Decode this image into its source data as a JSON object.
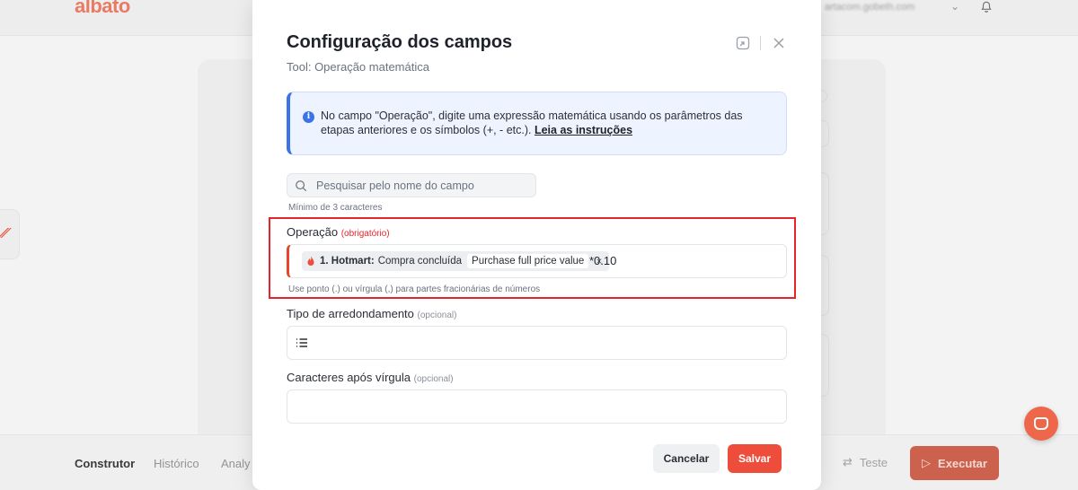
{
  "app": {
    "logo": "albato",
    "account": "artacom.gobeth.com",
    "bottom_tabs": [
      "Construtor",
      "Histórico",
      "Analy"
    ],
    "test_label": "Teste",
    "execute_label": "Executar"
  },
  "modal": {
    "title": "Configuração dos campos",
    "subtitle": "Tool: Operação matemática",
    "info": {
      "text": "No campo \"Operação\", digite uma expressão matemática usando os parâmetros das etapas anteriores e os símbolos (+, - etc.). ",
      "link": "Leia as instruções"
    },
    "search": {
      "placeholder": "Pesquisar pelo nome do campo",
      "hint": "Mínimo de 3 caracteres"
    },
    "fields": {
      "operacao": {
        "label": "Operação",
        "tag": "(obrigatório)",
        "chip_app": "1. Hotmart:",
        "chip_event": "Compra concluída",
        "chip_field": "Purchase full price value",
        "value": "*0.10",
        "hint": "Use ponto (.) ou vírgula (,) para partes fracionárias de números"
      },
      "tipo": {
        "label": "Tipo de arredondamento",
        "tag": "(opcional)"
      },
      "caracteres": {
        "label": "Caracteres após vírgula",
        "tag": "(opcional)"
      }
    },
    "buttons": {
      "cancel": "Cancelar",
      "save": "Salvar"
    }
  },
  "colors": {
    "accent": "#ee4d3b",
    "info_border": "#3b73e8",
    "highlight_box": "#e8232a"
  }
}
